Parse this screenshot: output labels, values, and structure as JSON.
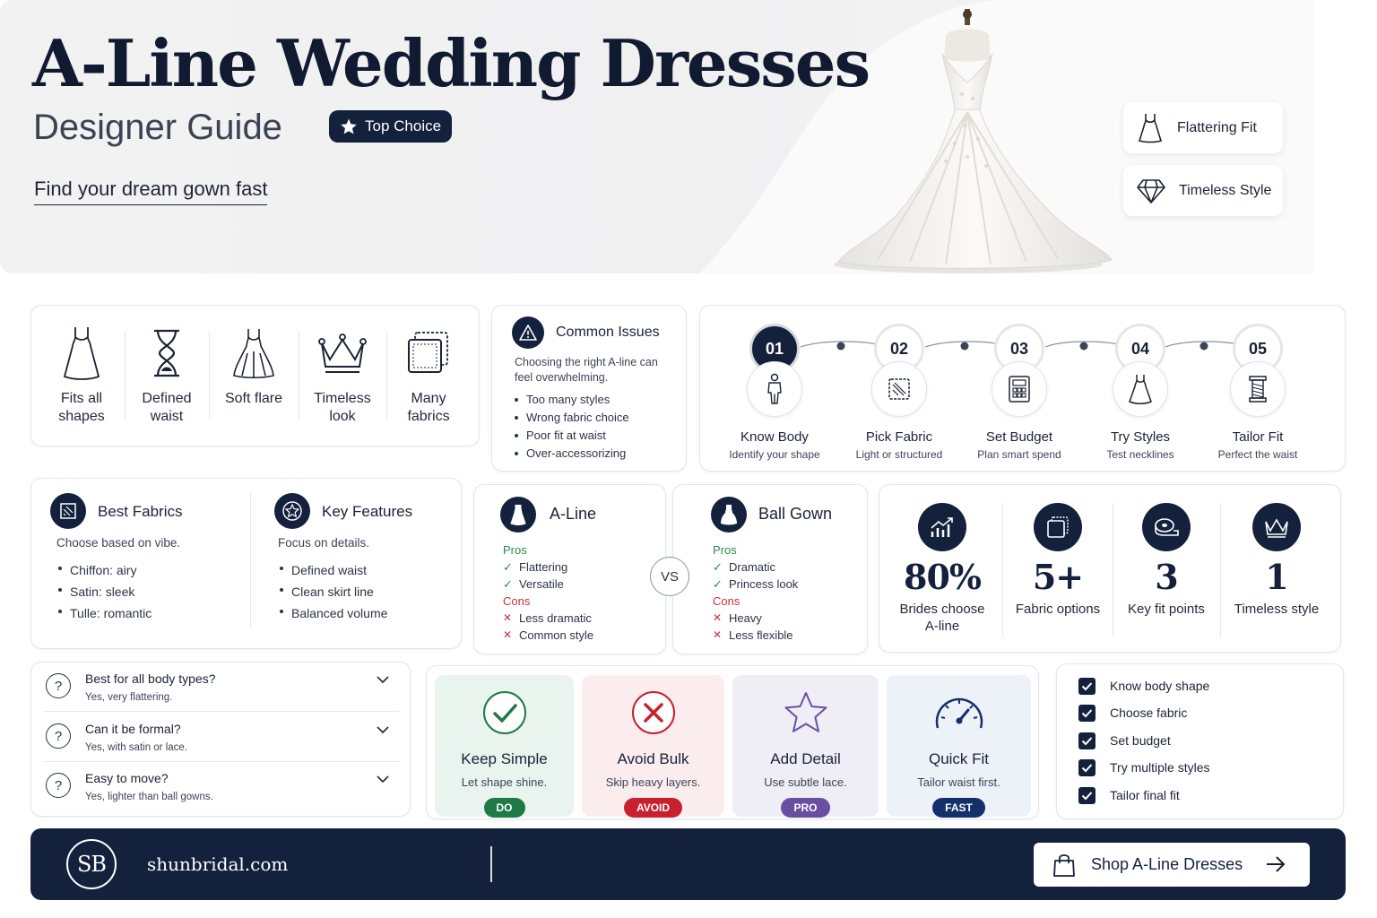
{
  "hero": {
    "title": "A-Line Wedding Dresses",
    "subtitle": "Designer Guide",
    "badge": "Top Choice",
    "tagline": "Find your dream gown fast",
    "pills": [
      {
        "label": "Flattering Fit",
        "icon": "dress-icon"
      },
      {
        "label": "Timeless Style",
        "icon": "diamond-icon"
      }
    ]
  },
  "features": [
    {
      "label": "Fits all shapes",
      "icon": "dress-icon"
    },
    {
      "label": "Defined waist",
      "icon": "hourglass-icon"
    },
    {
      "label": "Soft flare",
      "icon": "flared-dress-icon"
    },
    {
      "label": "Timeless look",
      "icon": "crown-icon"
    },
    {
      "label": "Many fabrics",
      "icon": "fabric-swatch-icon"
    }
  ],
  "issues": {
    "title": "Common Issues",
    "intro": "Choosing the right A-line can feel overwhelming.",
    "items": [
      "Too many styles",
      "Wrong fabric choice",
      "Poor fit at waist",
      "Over-accessorizing"
    ]
  },
  "steps": [
    {
      "num": "01",
      "title": "Know Body",
      "desc": "Identify your shape",
      "icon": "body-icon"
    },
    {
      "num": "02",
      "title": "Pick Fabric",
      "desc": "Light or structured",
      "icon": "fabric-icon"
    },
    {
      "num": "03",
      "title": "Set Budget",
      "desc": "Plan smart spend",
      "icon": "calculator-icon"
    },
    {
      "num": "04",
      "title": "Try Styles",
      "desc": "Test necklines",
      "icon": "dress-icon"
    },
    {
      "num": "05",
      "title": "Tailor Fit",
      "desc": "Perfect the waist",
      "icon": "thread-spool-icon"
    }
  ],
  "fabrics": {
    "title": "Best Fabrics",
    "intro": "Choose based on vibe.",
    "items": [
      "Chiffon: airy",
      "Satin: sleek",
      "Tulle: romantic"
    ]
  },
  "key_features": {
    "title": "Key Features",
    "intro": "Focus on details.",
    "items": [
      "Defined waist",
      "Clean skirt line",
      "Balanced volume"
    ]
  },
  "compare": {
    "vs": "VS",
    "pros_label": "Pros",
    "cons_label": "Cons",
    "left": {
      "title": "A-Line",
      "pros": [
        "Flattering",
        "Versatile"
      ],
      "cons": [
        "Less dramatic",
        "Common style"
      ]
    },
    "right": {
      "title": "Ball Gown",
      "pros": [
        "Dramatic",
        "Princess look"
      ],
      "cons": [
        "Heavy",
        "Less flexible"
      ]
    }
  },
  "stats": [
    {
      "value": "80%",
      "label": "Brides choose A-line",
      "icon": "growth-chart-icon"
    },
    {
      "value": "5+",
      "label": "Fabric options",
      "icon": "fabric-swatch-icon"
    },
    {
      "value": "3",
      "label": "Key fit points",
      "icon": "measuring-tape-icon"
    },
    {
      "value": "1",
      "label": "Timeless style",
      "icon": "crown-icon"
    }
  ],
  "faq": [
    {
      "q": "Best for all body types?",
      "a": "Yes, very flattering."
    },
    {
      "q": "Can it be formal?",
      "a": "Yes, with satin or lace."
    },
    {
      "q": "Easy to move?",
      "a": "Yes, lighter than ball gowns."
    }
  ],
  "tips": [
    {
      "title": "Keep Simple",
      "desc": "Let shape shine.",
      "tag": "DO",
      "bg": "#e9f4ee",
      "tag_color": "#1e7a46",
      "icon": "check-circle-icon"
    },
    {
      "title": "Avoid Bulk",
      "desc": "Skip heavy layers.",
      "tag": "AVOID",
      "bg": "#fbecee",
      "tag_color": "#c8202e",
      "icon": "x-circle-icon"
    },
    {
      "title": "Add Detail",
      "desc": "Use subtle lace.",
      "tag": "PRO",
      "bg": "#efedf6",
      "tag_color": "#6a4fa0",
      "icon": "star-icon"
    },
    {
      "title": "Quick Fit",
      "desc": "Tailor waist first.",
      "tag": "FAST",
      "bg": "#edf1f8",
      "tag_color": "#14306b",
      "icon": "speedometer-icon"
    }
  ],
  "checklist": [
    "Know body shape",
    "Choose fabric",
    "Set budget",
    "Try multiple styles",
    "Tailor final fit"
  ],
  "footer": {
    "logo": "SB",
    "site": "shunbridal.com",
    "cta": "Shop A-Line Dresses"
  },
  "colors": {
    "navy": "#14213d",
    "green": "#2e8b4f",
    "red": "#c8333a"
  }
}
